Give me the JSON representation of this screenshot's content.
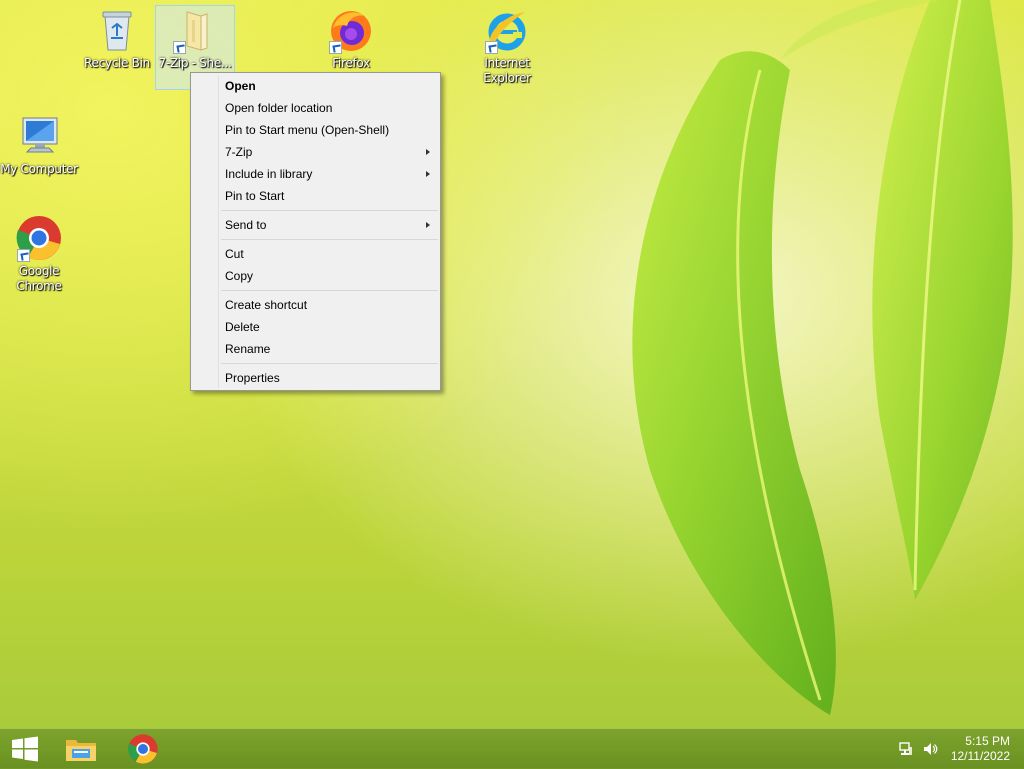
{
  "desktop": {
    "icons": [
      {
        "label": "Recycle Bin"
      },
      {
        "label": "7-Zip - She..."
      },
      {
        "label": "Firefox"
      },
      {
        "label": "Internet Explorer"
      },
      {
        "label": "My Computer"
      },
      {
        "label": "Google Chrome"
      }
    ]
  },
  "context_menu": {
    "items": [
      {
        "label": "Open"
      },
      {
        "label": "Open folder location"
      },
      {
        "label": "Pin to Start menu (Open-Shell)"
      },
      {
        "label": "7-Zip"
      },
      {
        "label": "Include in library"
      },
      {
        "label": "Pin to Start"
      },
      {
        "label": "Send to"
      },
      {
        "label": "Cut"
      },
      {
        "label": "Copy"
      },
      {
        "label": "Create shortcut"
      },
      {
        "label": "Delete"
      },
      {
        "label": "Rename"
      },
      {
        "label": "Properties"
      }
    ]
  },
  "taskbar": {
    "start_icon": "windows-logo-icon",
    "pinned": [
      {
        "icon": "file-explorer-icon"
      },
      {
        "icon": "chrome-icon"
      }
    ],
    "tray": {
      "network_icon": "network-icon",
      "volume_icon": "volume-icon",
      "time": "5:15 PM",
      "date": "12/11/2022"
    }
  }
}
